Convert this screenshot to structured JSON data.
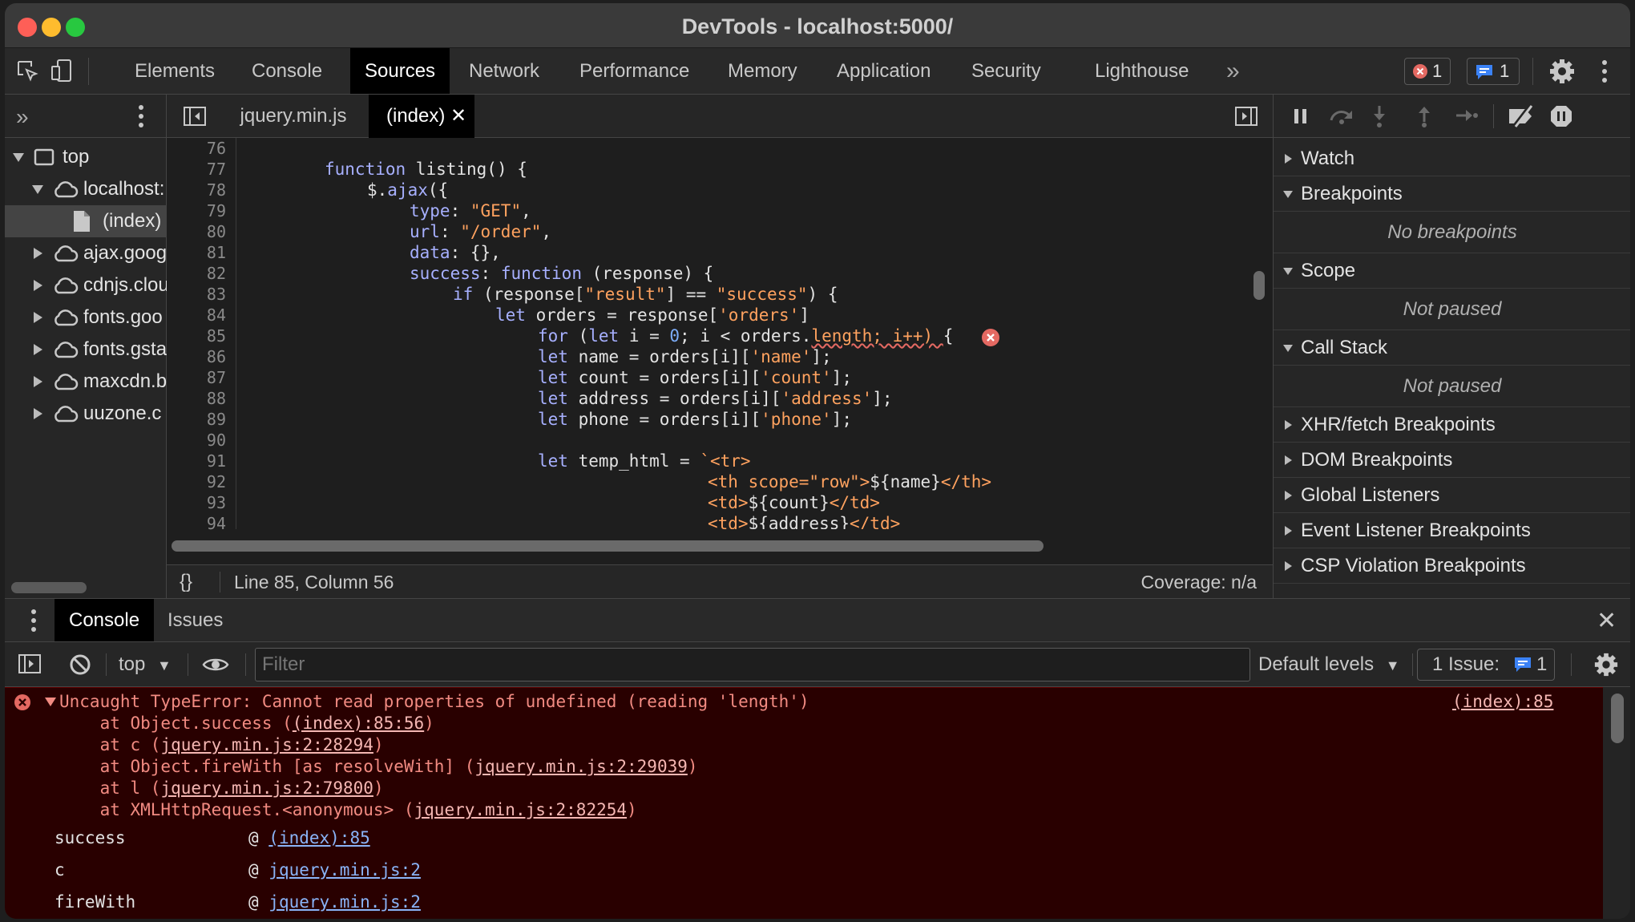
{
  "window": {
    "title": "DevTools - localhost:5000/"
  },
  "toolbar": {
    "tabs": [
      "Elements",
      "Console",
      "Sources",
      "Network",
      "Performance",
      "Memory",
      "Application",
      "Security",
      "Lighthouse"
    ],
    "active_tab": "Sources",
    "more_label": "»",
    "error_count": "1",
    "issue_count": "1"
  },
  "navigator": {
    "items": [
      {
        "label": "top",
        "icon": "frame-icon"
      },
      {
        "label": "localhost:",
        "icon": "cloud-icon"
      },
      {
        "label": "(index)",
        "icon": "file-icon"
      },
      {
        "label": "ajax.goog",
        "icon": "cloud-icon"
      },
      {
        "label": "cdnjs.clou",
        "icon": "cloud-icon"
      },
      {
        "label": "fonts.goo",
        "icon": "cloud-icon"
      },
      {
        "label": "fonts.gsta",
        "icon": "cloud-icon"
      },
      {
        "label": "maxcdn.b",
        "icon": "cloud-icon"
      },
      {
        "label": "uuzone.c",
        "icon": "cloud-icon"
      }
    ]
  },
  "editor": {
    "tabs": [
      "jquery.min.js",
      "(index)"
    ],
    "active_tab": "(index)",
    "line_numbers": [
      "76",
      "77",
      "78",
      "79",
      "80",
      "81",
      "82",
      "83",
      "84",
      "85",
      "86",
      "87",
      "88",
      "89",
      "90",
      "91",
      "92",
      "93",
      "94"
    ],
    "status_position": "Line 85, Column 56",
    "status_coverage": "Coverage: n/a"
  },
  "debugger": {
    "sections": {
      "watch": "Watch",
      "breakpoints": "Breakpoints",
      "breakpoints_body": "No breakpoints",
      "scope": "Scope",
      "scope_body": "Not paused",
      "callstack": "Call Stack",
      "callstack_body": "Not paused",
      "xhr": "XHR/fetch Breakpoints",
      "dom": "DOM Breakpoints",
      "global": "Global Listeners",
      "event": "Event Listener Breakpoints",
      "csp": "CSP Violation Breakpoints"
    }
  },
  "drawer": {
    "tabs": [
      "Console",
      "Issues"
    ],
    "active_tab": "Console",
    "context": "top",
    "filter_placeholder": "Filter",
    "levels": "Default levels",
    "issues_label": "1 Issue:",
    "issues_count": "1"
  },
  "console_error": {
    "message": "Uncaught TypeError: Cannot read properties of undefined (reading 'length')",
    "source": "(index):85",
    "stack": [
      {
        "prefix": "    at Object.success (",
        "link": "(index):85:56",
        "suffix": ")"
      },
      {
        "prefix": "    at c (",
        "link": "jquery.min.js:2:28294",
        "suffix": ")"
      },
      {
        "prefix": "    at Object.fireWith [as resolveWith] (",
        "link": "jquery.min.js:2:29039",
        "suffix": ")"
      },
      {
        "prefix": "    at l (",
        "link": "jquery.min.js:2:79800",
        "suffix": ")"
      },
      {
        "prefix": "    at XMLHttpRequest.<anonymous> (",
        "link": "jquery.min.js:2:82254",
        "suffix": ")"
      }
    ],
    "frames": [
      {
        "fn": "success",
        "link": "(index):85"
      },
      {
        "fn": "c",
        "link": "jquery.min.js:2"
      },
      {
        "fn": "fireWith",
        "link": "jquery.min.js:2"
      }
    ]
  },
  "colors": {
    "error_red": "#f28b82",
    "keyword": "#a7b0ff",
    "string": "#ffa25f",
    "number": "#7cacf8",
    "accent_blue": "#3b82f6"
  }
}
